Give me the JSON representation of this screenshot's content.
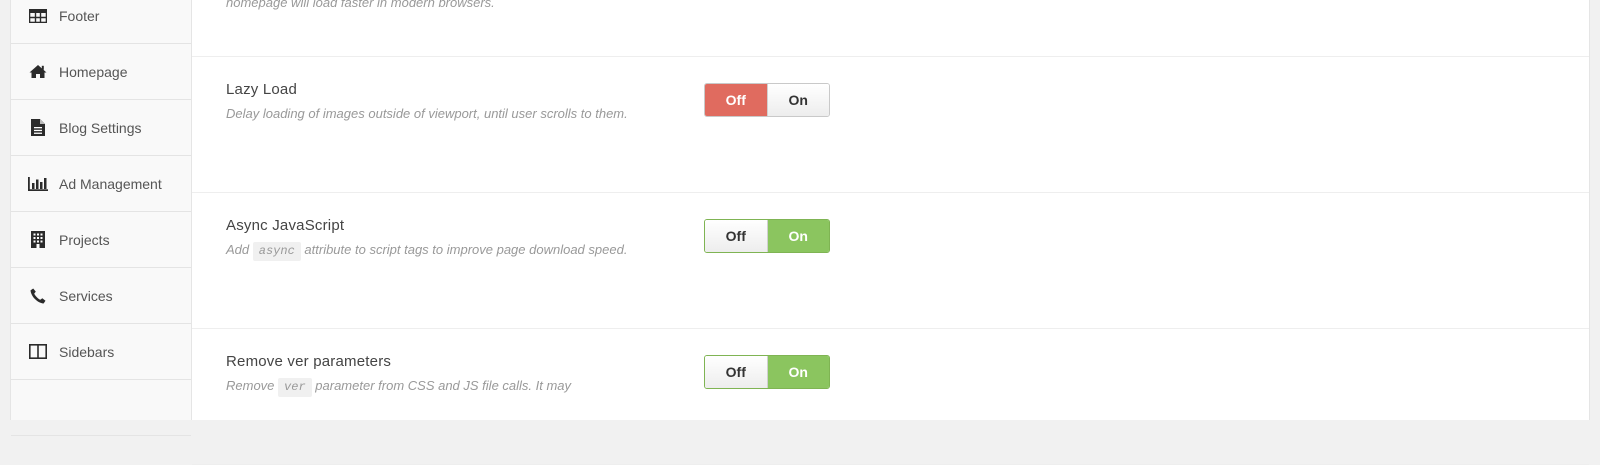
{
  "sidebar": {
    "items": [
      {
        "label": "Footer",
        "icon": "table-icon"
      },
      {
        "label": "Homepage",
        "icon": "home-icon"
      },
      {
        "label": "Blog Settings",
        "icon": "document-icon"
      },
      {
        "label": "Ad Management",
        "icon": "bar-chart-icon"
      },
      {
        "label": "Projects",
        "icon": "building-icon"
      },
      {
        "label": "Services",
        "icon": "phone-icon"
      },
      {
        "label": "Sidebars",
        "icon": "columns-icon"
      }
    ]
  },
  "settings": {
    "partial_desc": "homepage will load faster in modern browsers.",
    "lazy_load": {
      "title": "Lazy Load",
      "desc": "Delay loading of images outside of viewport, until user scrolls to them.",
      "off_label": "Off",
      "on_label": "On",
      "state": "off"
    },
    "async_js": {
      "title": "Async JavaScript",
      "desc_before": "Add",
      "desc_code": "async",
      "desc_after": "attribute to script tags to improve page download speed.",
      "off_label": "Off",
      "on_label": "On",
      "state": "on"
    },
    "remove_ver": {
      "title": "Remove ver parameters",
      "desc_before": "Remove",
      "desc_code": "ver",
      "desc_after": "parameter from CSS and JS file calls. It may",
      "off_label": "Off",
      "on_label": "On",
      "state": "on"
    }
  },
  "colors": {
    "off_active": "#e06b5f",
    "on_active": "#8bc55f"
  }
}
